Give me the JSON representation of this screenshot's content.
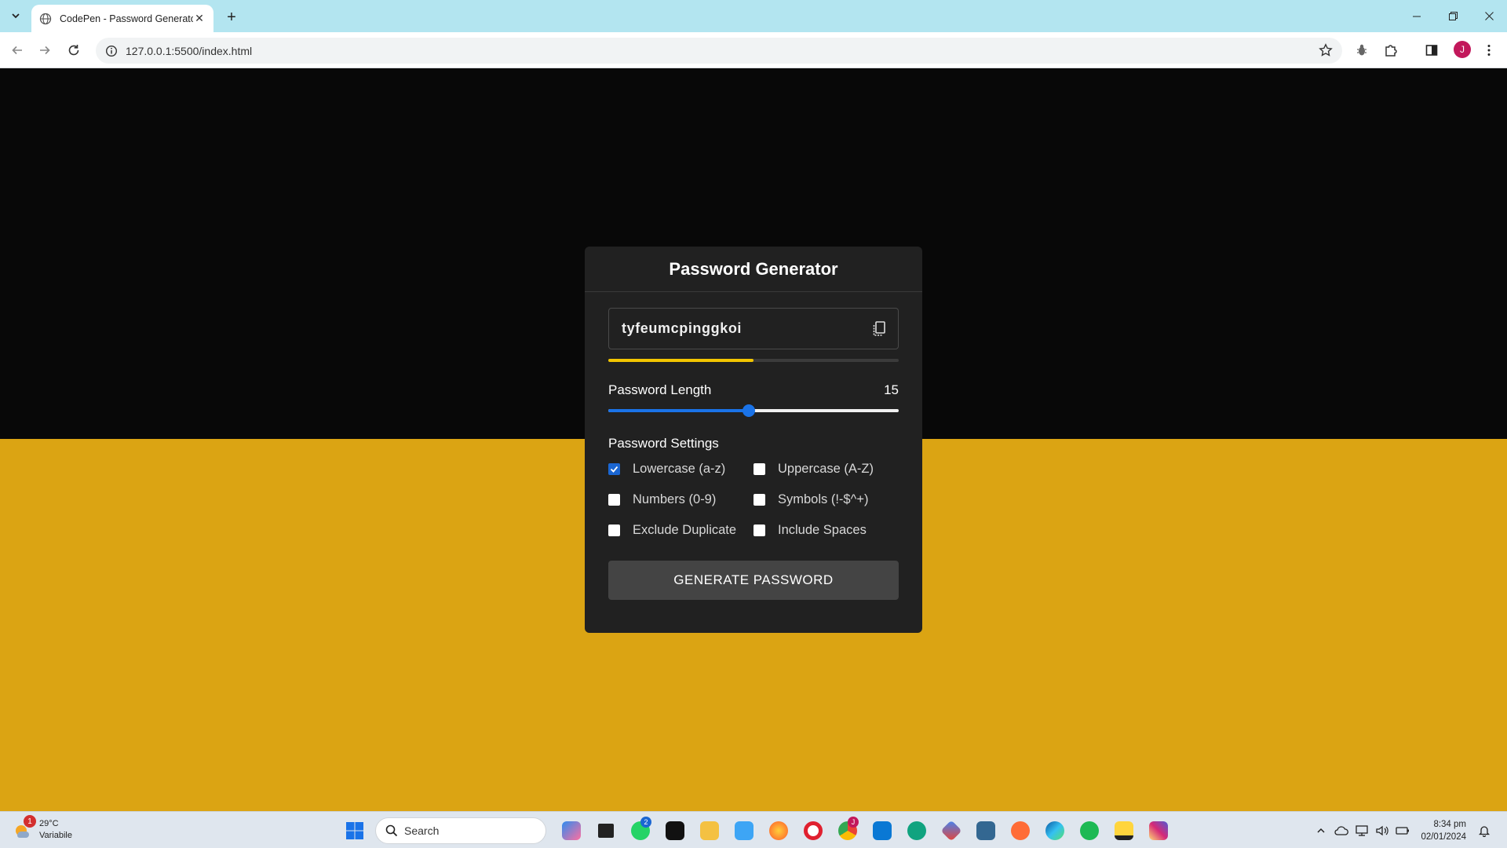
{
  "browser": {
    "tab_title": "CodePen - Password Generator",
    "url": "127.0.0.1:5500/index.html",
    "profile_initial": "J"
  },
  "app": {
    "title": "Password Generator",
    "password": "tyfeumcpinggkoi",
    "strength_fraction": 0.5,
    "length_label": "Password Length",
    "length_value": "15",
    "length_min": 1,
    "length_max": 30,
    "settings_title": "Password Settings",
    "options": [
      {
        "label": "Lowercase (a-z)",
        "checked": true
      },
      {
        "label": "Uppercase (A-Z)",
        "checked": false
      },
      {
        "label": "Numbers (0-9)",
        "checked": false
      },
      {
        "label": "Symbols (!-$^+)",
        "checked": false
      },
      {
        "label": "Exclude Duplicate",
        "checked": false
      },
      {
        "label": "Include Spaces",
        "checked": false
      }
    ],
    "generate_label": "GENERATE PASSWORD"
  },
  "colors": {
    "page_top": "#080808",
    "page_bottom": "#dba413",
    "card": "#212121",
    "accent": "#1a73e8",
    "strength": "#f2c500"
  },
  "taskbar": {
    "weather_temp": "29°C",
    "weather_desc": "Variabile",
    "weather_badge": "1",
    "search_placeholder": "Search",
    "time": "8:34 pm",
    "date": "02/01/2024",
    "whatsapp_badge": "2",
    "chrome_badge": "J"
  }
}
